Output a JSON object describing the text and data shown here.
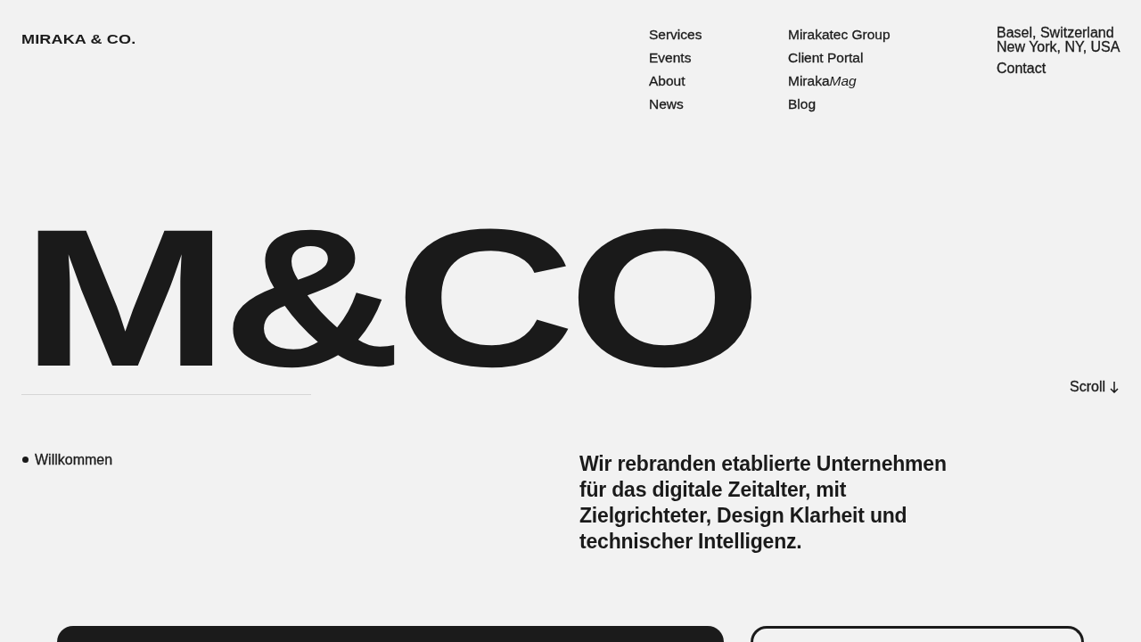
{
  "header": {
    "logo": "MIRAKA & CO.",
    "nav_columns": [
      {
        "items": [
          {
            "label": "Services"
          },
          {
            "label": "Events"
          },
          {
            "label": "About"
          },
          {
            "label": "News"
          }
        ]
      },
      {
        "items": [
          {
            "label": "Mirakatec Group"
          },
          {
            "label": "Client Portal"
          },
          {
            "label": "Miraka",
            "label_italic": "Mag"
          },
          {
            "label": "Blog"
          }
        ]
      }
    ],
    "locations": [
      "Basel, Switzerland",
      "New York, NY, USA"
    ],
    "contact": "Contact"
  },
  "hero": {
    "wordmark": "M&CO",
    "scroll_label": "Scroll"
  },
  "intro": {
    "label": "Willkommen",
    "tagline": "Wir rebranden etablierte Unternehmen für das digitale Zeitalter, mit Zielgrichteter, Design Klarheit und technischer Intelligenz."
  },
  "cards": [
    {
      "kind": "filled"
    },
    {
      "kind": "outlined"
    }
  ]
}
